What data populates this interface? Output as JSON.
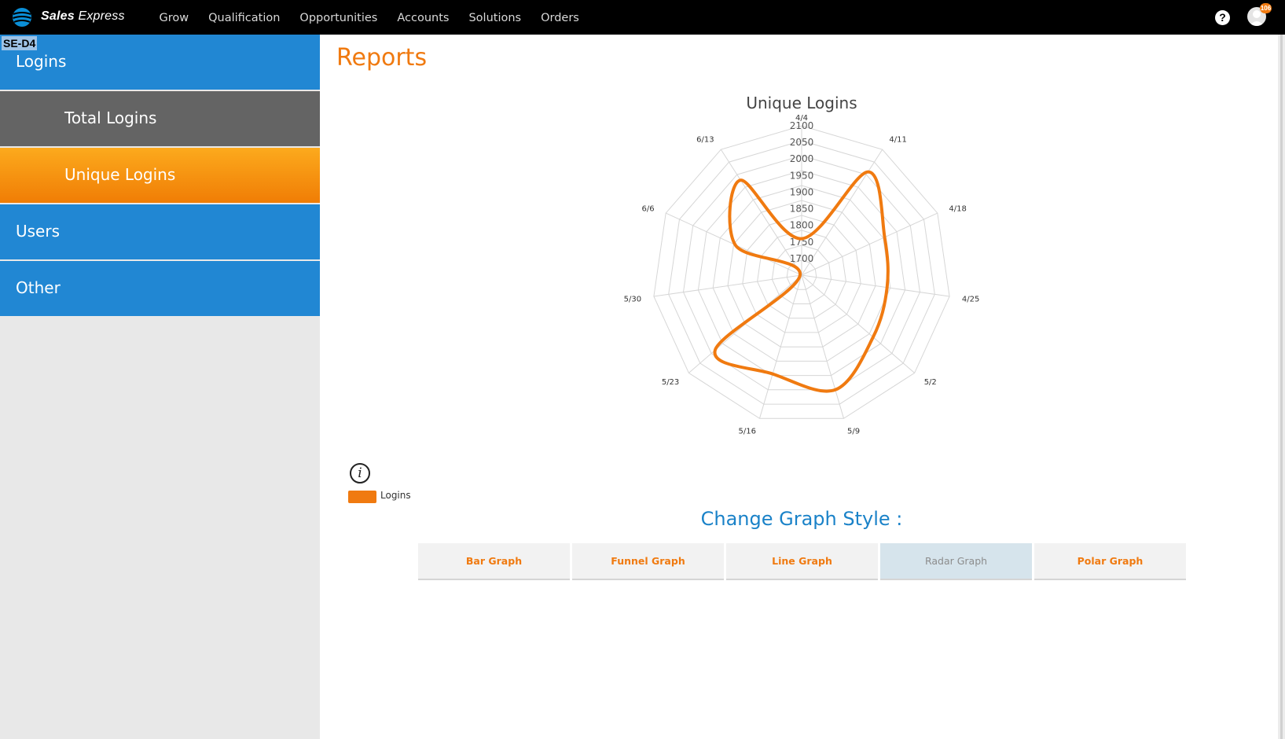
{
  "brand": {
    "name_bold": "Sales",
    "name_light": "Express"
  },
  "nav": [
    "Grow",
    "Qualification",
    "Opportunities",
    "Accounts",
    "Solutions",
    "Orders"
  ],
  "header": {
    "help_symbol": "?",
    "notification_count": "106"
  },
  "env_tag": "SE-D4",
  "sidebar": {
    "items": [
      {
        "label": "Logins",
        "style": "blue"
      },
      {
        "label": "Total Logins",
        "style": "gray"
      },
      {
        "label": "Unique Logins",
        "style": "orange"
      },
      {
        "label": "Users",
        "style": "blue"
      },
      {
        "label": "Other",
        "style": "blue"
      }
    ]
  },
  "page": {
    "title": "Reports"
  },
  "legend": {
    "info_symbol": "i",
    "label": "Logins"
  },
  "change_style": {
    "title": "Change Graph Style :"
  },
  "graph_buttons": [
    {
      "label": "Bar Graph",
      "active": false
    },
    {
      "label": "Funnel Graph",
      "active": false
    },
    {
      "label": "Line Graph",
      "active": false
    },
    {
      "label": "Radar Graph",
      "active": true
    },
    {
      "label": "Polar Graph",
      "active": false
    }
  ],
  "colors": {
    "accent": "#f07a10",
    "sidebar_blue": "#2187d3",
    "heading_blue": "#1a82c8"
  },
  "chart_data": {
    "type": "radar",
    "title": "Unique Logins",
    "categories": [
      "4/4",
      "4/11",
      "4/18",
      "4/25",
      "5/2",
      "5/9",
      "5/16",
      "5/23",
      "5/30",
      "6/6",
      "6/13"
    ],
    "series": [
      {
        "name": "Logins",
        "values": [
          1760,
          2020,
          1925,
          1910,
          1935,
          2010,
          1960,
          1995,
          1655,
          1870,
          1990
        ]
      }
    ],
    "r_ticks": [
      1700,
      1750,
      1800,
      1850,
      1900,
      1950,
      2000,
      2050,
      2100
    ],
    "rlim": [
      1650,
      2100
    ],
    "grid": true,
    "legend_position": "bottom-left"
  }
}
